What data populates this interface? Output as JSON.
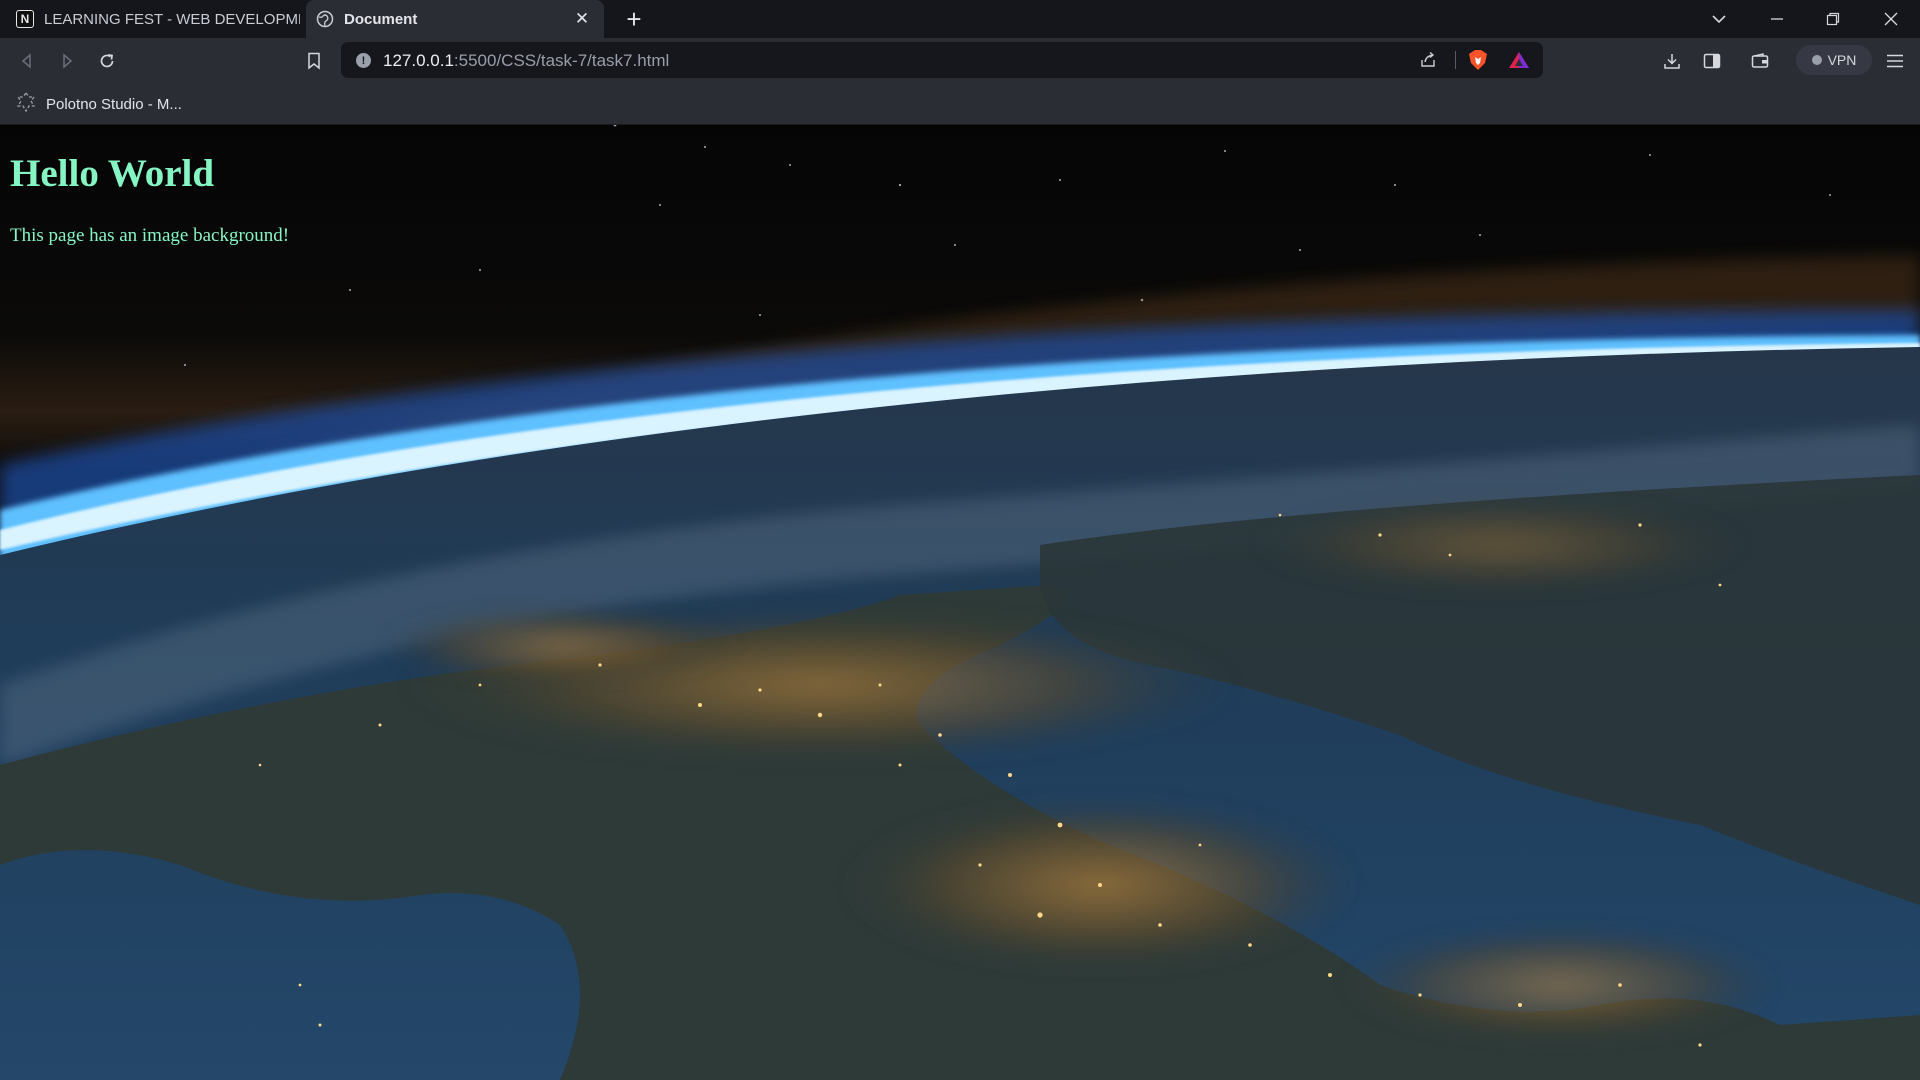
{
  "browser": {
    "tabs": [
      {
        "title": "LEARNING FEST - WEB DEVELOPMENT",
        "icon": "notion-icon",
        "active": false
      },
      {
        "title": "Document",
        "icon": "globe-icon",
        "active": true
      }
    ],
    "address": {
      "host": "127.0.0.1",
      "path": ":5500/CSS/task-7/task7.html"
    },
    "vpn_label": "VPN",
    "bookmarks": [
      {
        "label": "Polotno Studio - M...",
        "icon": "polotno-icon"
      }
    ]
  },
  "page": {
    "heading": "Hello World",
    "text": "This page has an image background!",
    "text_color": "#86f5c4",
    "background": "earth-at-night-from-space-photo"
  },
  "colors": {
    "tabstrip": "#14161c",
    "toolbar": "#2b2d35",
    "addressbar": "#15171d"
  }
}
